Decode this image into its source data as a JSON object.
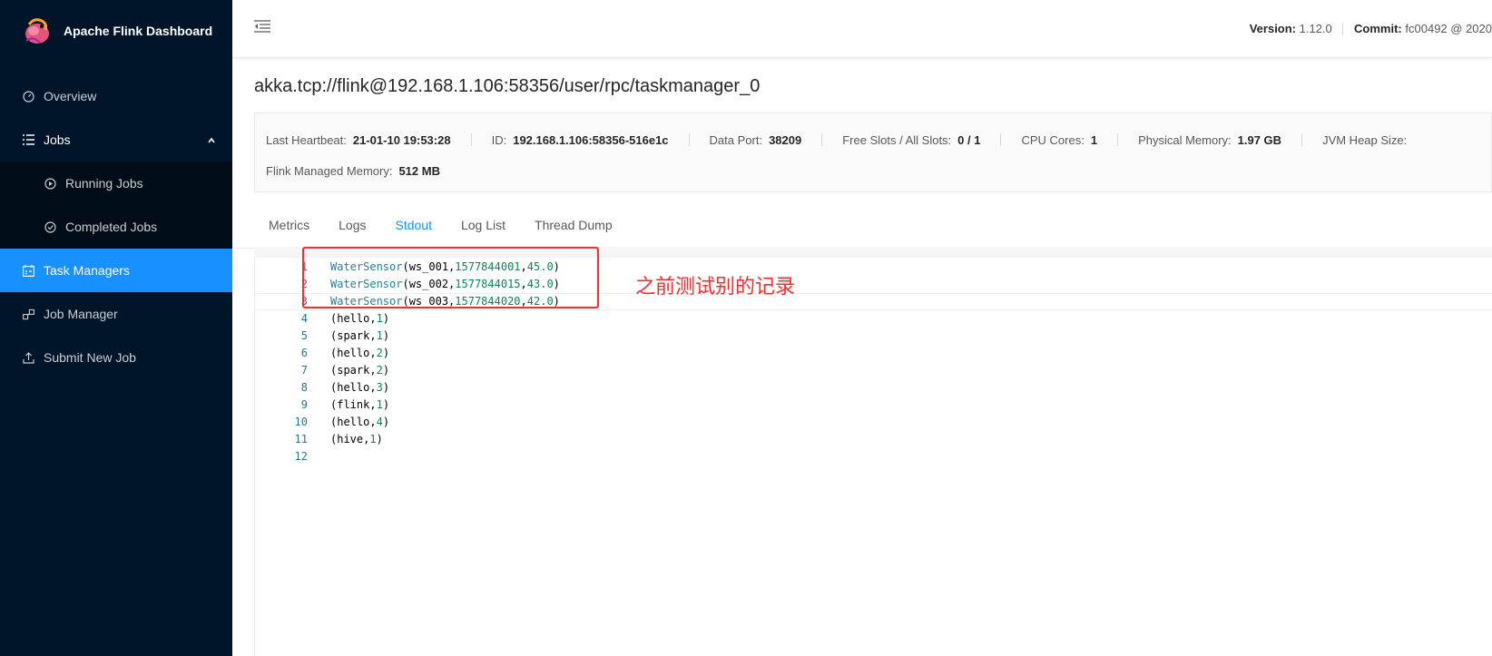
{
  "app": {
    "title": "Apache Flink Dashboard"
  },
  "sidebar": {
    "items": [
      {
        "label": "Overview",
        "icon": "dashboard-icon"
      },
      {
        "label": "Jobs",
        "icon": "list-icon"
      },
      {
        "label": "Running Jobs",
        "icon": "play-circle-icon"
      },
      {
        "label": "Completed Jobs",
        "icon": "check-circle-icon"
      },
      {
        "label": "Task Managers",
        "icon": "schedule-icon"
      },
      {
        "label": "Job Manager",
        "icon": "cluster-icon"
      },
      {
        "label": "Submit New Job",
        "icon": "upload-icon"
      }
    ]
  },
  "topbar": {
    "version_label": "Version:",
    "version_value": "1.12.0",
    "commit_label": "Commit:",
    "commit_value": "fc00492 @ 2020"
  },
  "page": {
    "title": "akka.tcp://flink@192.168.1.106:58356/user/rpc/taskmanager_0"
  },
  "info": {
    "heartbeat_label": "Last Heartbeat:",
    "heartbeat_value": "21-01-10 19:53:28",
    "id_label": "ID:",
    "id_value": "192.168.1.106:58356-516e1c",
    "data_port_label": "Data Port:",
    "data_port_value": "38209",
    "slots_label": "Free Slots / All Slots:",
    "slots_value": "0 / 1",
    "cpu_label": "CPU Cores:",
    "cpu_value": "1",
    "phys_mem_label": "Physical Memory:",
    "phys_mem_value": "1.97 GB",
    "jvm_heap_label": "JVM Heap Size:",
    "managed_mem_label": "Flink Managed Memory:",
    "managed_mem_value": "512 MB"
  },
  "tabs": [
    "Metrics",
    "Logs",
    "Stdout",
    "Log List",
    "Thread Dump"
  ],
  "stdout": {
    "line_numbers": [
      "1",
      "2",
      "3",
      "4",
      "5",
      "6",
      "7",
      "8",
      "9",
      "10",
      "11",
      "12"
    ],
    "lines": [
      "WaterSensor(ws_001,1577844001,45.0)",
      "WaterSensor(ws_002,1577844015,43.0)",
      "WaterSensor(ws_003,1577844020,42.0)",
      "(hello,1)",
      "(spark,1)",
      "(hello,2)",
      "(spark,2)",
      "(hello,3)",
      "(flink,1)",
      "(hello,4)",
      "(hive,1)",
      ""
    ]
  },
  "annotation": {
    "text": "之前测试别的记录",
    "color": "#ff2a2a"
  },
  "colors": {
    "sidebar_bg": "#001529",
    "accent": "#1890ff",
    "annotation": "#ff2a2a"
  }
}
